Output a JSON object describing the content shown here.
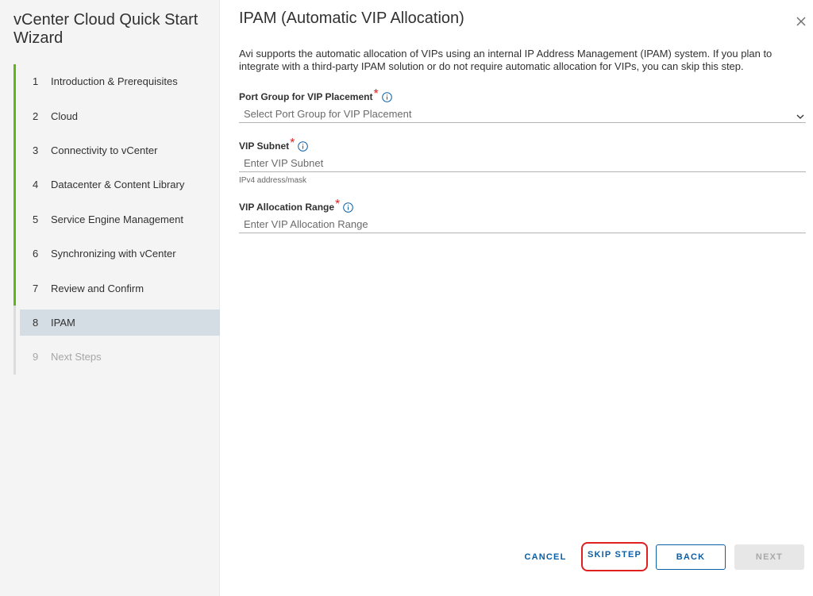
{
  "sidebar": {
    "title": "vCenter Cloud Quick Start Wizard",
    "steps": [
      {
        "num": "1",
        "label": "Introduction & Prerequisites"
      },
      {
        "num": "2",
        "label": "Cloud"
      },
      {
        "num": "3",
        "label": "Connectivity to vCenter"
      },
      {
        "num": "4",
        "label": "Datacenter & Content Library"
      },
      {
        "num": "5",
        "label": "Service Engine Management"
      },
      {
        "num": "6",
        "label": "Synchronizing with vCenter"
      },
      {
        "num": "7",
        "label": "Review and Confirm"
      },
      {
        "num": "8",
        "label": "IPAM"
      },
      {
        "num": "9",
        "label": "Next Steps"
      }
    ],
    "active_step": "8"
  },
  "main": {
    "title": "IPAM (Automatic VIP Allocation)",
    "description": "Avi supports the automatic allocation of VIPs using an internal IP Address Management (IPAM) system. If you plan to integrate with a third-party IPAM solution or do not require automatic allocation for VIPs, you can skip this step.",
    "fields": {
      "port_group": {
        "label": "Port Group for VIP Placement",
        "placeholder": "Select Port Group for VIP Placement"
      },
      "vip_subnet": {
        "label": "VIP Subnet",
        "placeholder": "Enter VIP Subnet",
        "helper": "IPv4 address/mask"
      },
      "vip_range": {
        "label": "VIP Allocation Range",
        "placeholder": "Enter VIP Allocation Range"
      }
    },
    "required_mark": "*"
  },
  "footer": {
    "cancel": "CANCEL",
    "skip": "SKIP STEP",
    "back": "BACK",
    "next": "NEXT"
  },
  "colors": {
    "completed_step_bar": "#5eb715",
    "active_step_bg": "#d5dde4",
    "link_blue": "#0b5fa5",
    "highlight_red": "#e01f1f"
  },
  "icons": {
    "close": "close-icon",
    "info": "info-icon",
    "dropdown": "chevron-down-icon"
  }
}
